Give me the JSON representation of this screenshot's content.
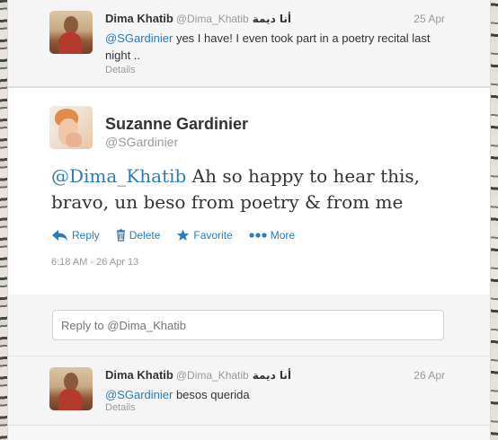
{
  "tweets_above": [
    {
      "fullname": "Dima Khatib",
      "screenname": "@Dima_Khatib",
      "arabic_name": "أنا ديمة",
      "time": "25 Apr",
      "mention": "@SGardinier",
      "text": " yes I have! I even took part in a poetry recital last night ..",
      "details": "Details"
    }
  ],
  "focused_tweet": {
    "fullname": "Suzanne Gardinier",
    "screenname": "@SGardinier",
    "mention": "@Dima_Khatib",
    "text": " Ah so happy to hear this, bravo, un beso from poetry & from me",
    "actions": {
      "reply": "Reply",
      "delete": "Delete",
      "favorite": "Favorite",
      "more": "More"
    },
    "timestamp": "6:18 AM - 26 Apr 13"
  },
  "reply_box": {
    "placeholder": "Reply to @Dima_Khatib"
  },
  "tweets_below": [
    {
      "fullname": "Dima Khatib",
      "screenname": "@Dima_Khatib",
      "arabic_name": "أنا ديمة",
      "time": "26 Apr",
      "mention": "@SGardinier",
      "text": " besos querida",
      "details": "Details"
    }
  ],
  "colors": {
    "link": "#2b7bb9",
    "muted": "#999999",
    "text": "#333333"
  },
  "icons": [
    "reply-icon",
    "trash-icon",
    "star-icon",
    "more-dots-icon"
  ]
}
